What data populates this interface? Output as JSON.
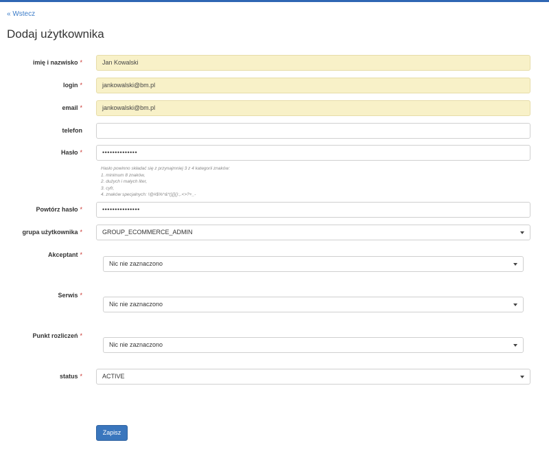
{
  "nav": {
    "back_label": "« Wstecz"
  },
  "page": {
    "title": "Dodaj użytkownika"
  },
  "form": {
    "required_mark": "*",
    "name": {
      "label": "imię i nazwisko",
      "value": "Jan Kowalski"
    },
    "login": {
      "label": "login",
      "value": "jankowalski@bm.pl"
    },
    "email": {
      "label": "email",
      "value": "jankowalski@bm.pl"
    },
    "phone": {
      "label": "telefon",
      "value": ""
    },
    "password": {
      "label": "Hasło",
      "value": "••••••••••••••",
      "hint": [
        "Hasło powinno składać się z przynajmniej 3 z 4 kategorii znaków:",
        "1. minimum 8 znaków,",
        "2. dużych i małych liter,",
        "3. cyfr,",
        "4. znaków specjalnych: !@#$%^&*()[]{}:,.<>?+_-"
      ]
    },
    "password_repeat": {
      "label": "Powtórz hasło",
      "value": "•••••••••••••••"
    },
    "user_group": {
      "label": "grupa użytkownika",
      "value": "GROUP_ECOMMERCE_ADMIN"
    },
    "acceptant": {
      "label": "Akceptant",
      "value": "Nic nie zaznaczono"
    },
    "service": {
      "label": "Serwis",
      "value": "Nic nie zaznaczono"
    },
    "settlement_point": {
      "label": "Punkt rozliczeń",
      "value": "Nic nie zaznaczono"
    },
    "status": {
      "label": "status",
      "value": "ACTIVE"
    },
    "save_label": "Zapisz"
  },
  "colors": {
    "accent": "#3a76bd",
    "autofill": "#f8f1c8",
    "required": "#c9302c"
  }
}
